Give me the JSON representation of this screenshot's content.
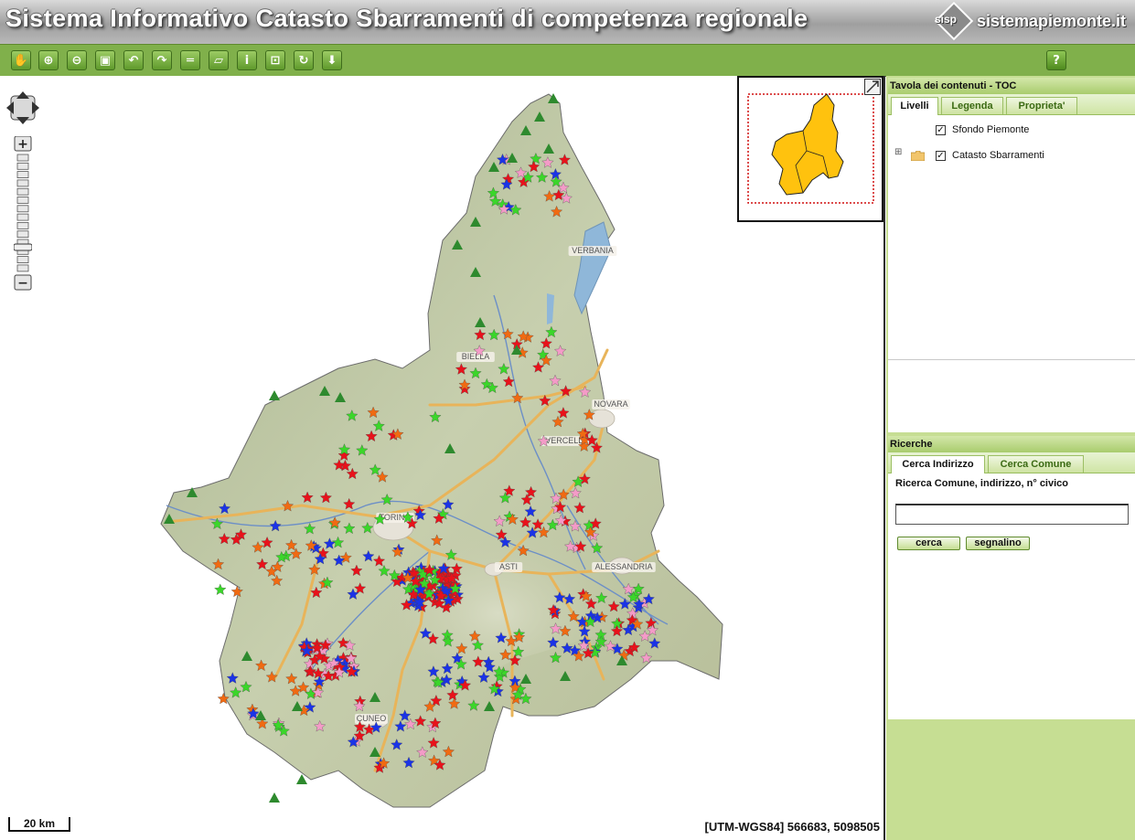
{
  "header": {
    "title": "Sistema Informativo Catasto Sbarramenti di competenza regionale",
    "logo_small": "sisp",
    "logo_site": "sistemapiemonte.it"
  },
  "toolbar": {
    "tools": [
      {
        "name": "pan-tool-button",
        "icon": "hand-icon",
        "glyph": "✋"
      },
      {
        "name": "zoom-in-tool-button",
        "icon": "zoom-in-icon",
        "glyph": "⊕"
      },
      {
        "name": "zoom-out-tool-button",
        "icon": "zoom-out-icon",
        "glyph": "⊖"
      },
      {
        "name": "zoom-extent-button",
        "icon": "zoom-extent-icon",
        "glyph": "▣"
      },
      {
        "name": "previous-view-button",
        "icon": "undo-arrow-icon",
        "glyph": "↶"
      },
      {
        "name": "next-view-button",
        "icon": "redo-arrow-icon",
        "glyph": "↷"
      },
      {
        "name": "measure-distance-button",
        "icon": "ruler-icon",
        "glyph": "═"
      },
      {
        "name": "measure-area-button",
        "icon": "area-ruler-icon",
        "glyph": "▱"
      },
      {
        "name": "info-button",
        "icon": "info-icon",
        "glyph": "i"
      },
      {
        "name": "info-select-button",
        "icon": "select-info-icon",
        "glyph": "⊡"
      },
      {
        "name": "refresh-button",
        "icon": "refresh-icon",
        "glyph": "↻"
      },
      {
        "name": "download-button",
        "icon": "download-arrow-icon",
        "glyph": "⬇"
      }
    ],
    "help_glyph": "?"
  },
  "map": {
    "place_labels": [
      "VERBANIA",
      "BIELLA",
      "NOVARA",
      "VERCELLI",
      "TORINO",
      "ASTI",
      "ALESSANDRIA",
      "CUNEO"
    ],
    "scale_label": "20 km",
    "coords": "[UTM-WGS84] 566683, 5098505",
    "marker_colors": {
      "red": "#e8121b",
      "blue": "#1b33e6",
      "green": "#3bd62a",
      "orange": "#f06a12",
      "pink": "#f39bc7",
      "triangle": "#2e8a2e"
    }
  },
  "toc": {
    "title": "Tavola dei contenuti - TOC",
    "tabs": [
      "Livelli",
      "Legenda",
      "Proprieta'"
    ],
    "active_tab": "Livelli",
    "layers": [
      {
        "label": "Sfondo Piemonte",
        "checked": true
      },
      {
        "label": "Catasto Sbarramenti",
        "checked": true
      }
    ]
  },
  "search": {
    "title": "Ricerche",
    "tabs": [
      "Cerca Indirizzo",
      "Cerca Comune"
    ],
    "active_tab": "Cerca Indirizzo",
    "prompt": "Ricerca Comune, indirizzo, n° civico",
    "input_value": "",
    "search_button": "cerca",
    "marker_button": "segnalino"
  }
}
